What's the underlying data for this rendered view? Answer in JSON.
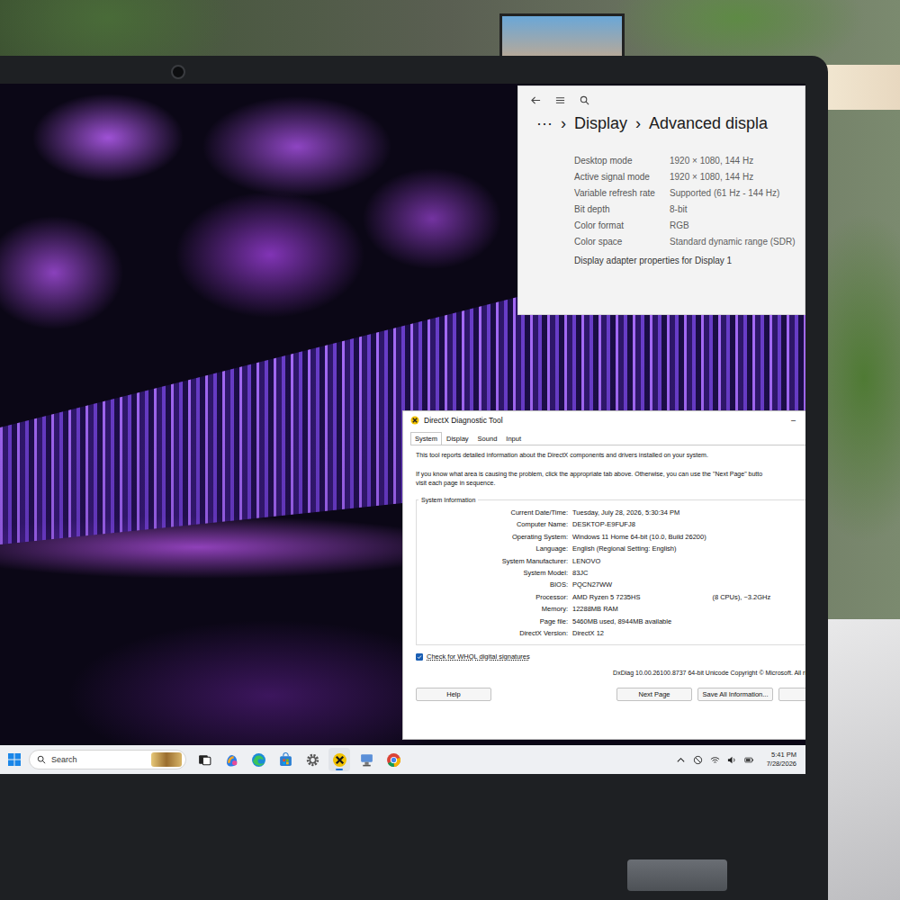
{
  "settings": {
    "breadcrumb": [
      "···",
      "›",
      "Display",
      "›",
      "Advanced displa"
    ],
    "rows": [
      {
        "label": "Desktop mode",
        "value": "1920 × 1080, 144 Hz"
      },
      {
        "label": "Active signal mode",
        "value": "1920 × 1080, 144 Hz"
      },
      {
        "label": "Variable refresh rate",
        "value": "Supported (61 Hz - 144 Hz)"
      },
      {
        "label": "Bit depth",
        "value": "8-bit"
      },
      {
        "label": "Color format",
        "value": "RGB"
      },
      {
        "label": "Color space",
        "value": "Standard dynamic range (SDR)"
      }
    ],
    "link": "Display adapter properties for Display 1"
  },
  "dxdiag": {
    "title": "DirectX Diagnostic Tool",
    "minimize": "–",
    "tabs": [
      {
        "label": "System",
        "selected": true
      },
      {
        "label": "Display",
        "selected": false
      },
      {
        "label": "Sound",
        "selected": false
      },
      {
        "label": "Input",
        "selected": false
      }
    ],
    "intro": [
      "This tool reports detailed information about the DirectX components and drivers installed on your system.",
      "If you know what area is causing the problem, click the appropriate tab above.  Otherwise, you can use the \"Next Page\" butto",
      "visit each page in sequence."
    ],
    "group": "System Information",
    "rows": [
      {
        "label": "Current Date/Time:",
        "value": "Tuesday, July 28, 2026, 5:30:34 PM",
        "extra": ""
      },
      {
        "label": "Computer Name:",
        "value": "DESKTOP-E9FUFJ8",
        "extra": ""
      },
      {
        "label": "Operating System:",
        "value": "Windows 11 Home 64-bit (10.0, Build 26200)",
        "extra": ""
      },
      {
        "label": "Language:",
        "value": "English (Regional Setting: English)",
        "extra": ""
      },
      {
        "label": "System Manufacturer:",
        "value": "LENOVO",
        "extra": ""
      },
      {
        "label": "System Model:",
        "value": "83JC",
        "extra": ""
      },
      {
        "label": "BIOS:",
        "value": "PQCN27WW",
        "extra": ""
      },
      {
        "label": "Processor:",
        "value": "AMD Ryzen 5 7235HS",
        "extra": "(8 CPUs), ~3.2GHz"
      },
      {
        "label": "Memory:",
        "value": "12288MB RAM",
        "extra": ""
      },
      {
        "label": "Page file:",
        "value": "5460MB used, 8944MB available",
        "extra": ""
      },
      {
        "label": "DirectX Version:",
        "value": "DirectX 12",
        "extra": ""
      }
    ],
    "checkbox": {
      "label": "Check for WHQL digital signatures",
      "checked": true
    },
    "footer": "DxDiag 10.00.26100.8737 64-bit Unicode  Copyright © Microsoft. All ri",
    "buttons": [
      "Help",
      "Next Page",
      "Save All Information...",
      ""
    ]
  },
  "taskbar": {
    "search": "Search",
    "apps": [
      {
        "kind": "taskview",
        "active": false
      },
      {
        "kind": "copilot",
        "active": false
      },
      {
        "kind": "edge",
        "active": false
      },
      {
        "kind": "store",
        "active": false
      },
      {
        "kind": "settings",
        "active": false
      },
      {
        "kind": "dxdiag",
        "active": true
      },
      {
        "kind": "network",
        "active": false
      },
      {
        "kind": "chrome",
        "active": false
      }
    ],
    "time": "5:41 PM",
    "date": "7/28/2026"
  }
}
